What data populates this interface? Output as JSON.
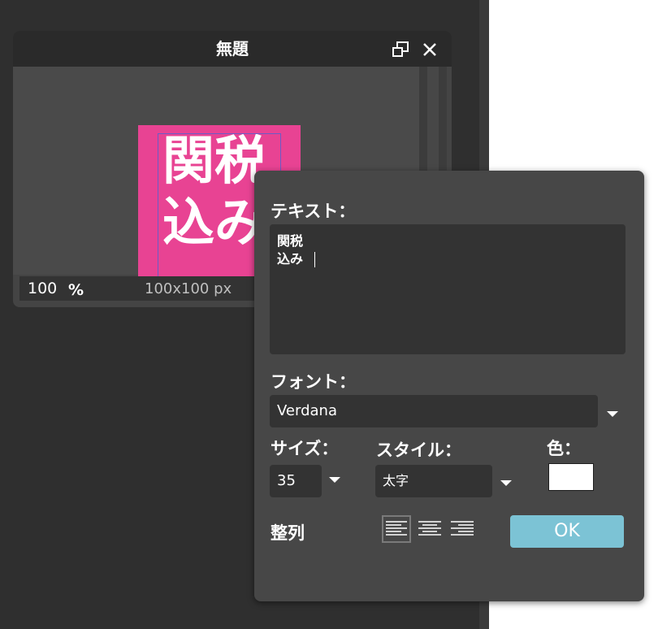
{
  "document": {
    "title": "無題",
    "canvas_text_line1": "関税",
    "canvas_text_line2": "込み",
    "canvas_color": "#e84393",
    "zoom_value": "100",
    "zoom_unit": "%",
    "size_text": "100x100 px",
    "restore_icon": "restore-window-icon",
    "close_icon": "close-icon"
  },
  "text_dialog": {
    "text_label": "テキスト：",
    "text_value_line1": "関税",
    "text_value_line2": "込み",
    "font_label": "フォント：",
    "font_value": "Verdana",
    "size_label": "サイズ：",
    "size_value": "35",
    "style_label": "スタイル：",
    "style_value": "太字",
    "color_label": "色：",
    "color_value": "#ffffff",
    "align_label": "整列",
    "align_options": [
      "left",
      "center",
      "right"
    ],
    "align_selected": "left",
    "ok_label": "OK",
    "accent_color": "#7cc3d5"
  }
}
